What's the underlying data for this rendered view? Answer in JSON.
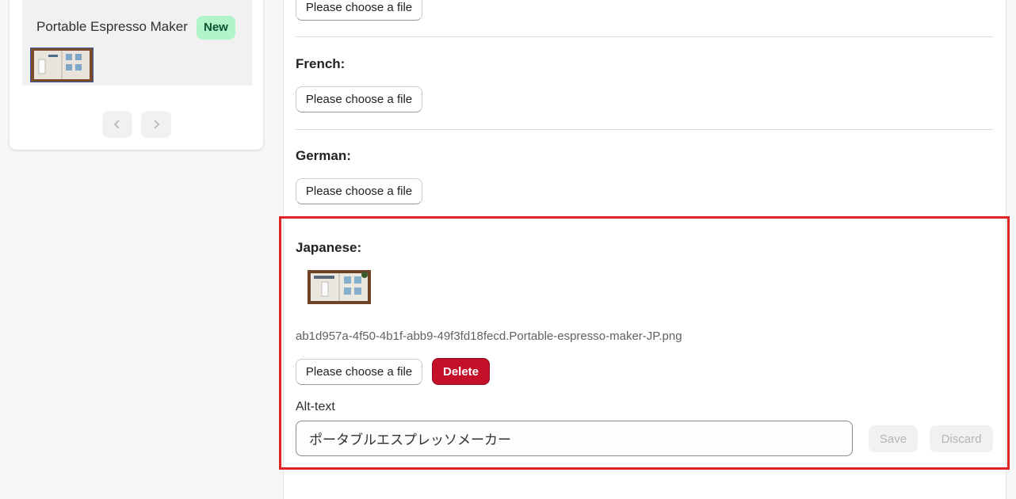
{
  "left": {
    "product_title": "Portable Espresso Maker",
    "badge": "New",
    "thumb_alt": "Portable espresso maker product image",
    "prev_icon": "chevron-left-icon",
    "next_icon": "chevron-right-icon"
  },
  "sections": [
    {
      "label": "French:",
      "button": "Please choose a file"
    },
    {
      "label": "German:",
      "button": "Please choose a file"
    }
  ],
  "top_button": "Please choose a file",
  "japanese": {
    "label": "Japanese:",
    "filename": "ab1d957a-4f50-4b1f-abb9-49f3fd18fecd.Portable-espresso-maker-JP.png",
    "choose_button": "Please choose a file",
    "delete_button": "Delete",
    "alt_label": "Alt-text",
    "alt_value": "ポータブルエスプレッソメーカー",
    "save_button": "Save",
    "discard_button": "Discard"
  },
  "colors": {
    "badge_bg": "#aff5c9",
    "delete_bg": "#c5102a",
    "highlight": "#e02424"
  }
}
